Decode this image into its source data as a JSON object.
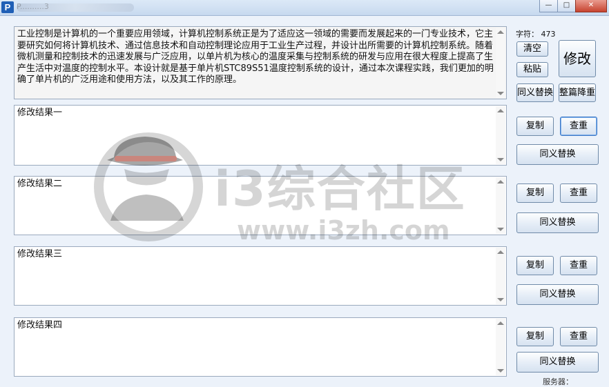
{
  "window": {
    "icon_letter": "P",
    "title_obscured": "P..........3",
    "minimize": "—",
    "maximize": "□",
    "close": "✕"
  },
  "source_text": "工业控制是计算机的一个重要应用领域，计算机控制系统正是为了适应这一领域的需要而发展起来的一门专业技术，它主要研究如何将计算机技术、通过信息技术和自动控制理论应用于工业生产过程，并设计出所需要的计算机控制系统。随着微机测量和控制技术的迅速发展与广泛应用，以单片机为核心的温度采集与控制系统的研发与应用在很大程度上提高了生产生活中对温度的控制水平。本设计就是基于单片机STC89S51温度控制系统的设计，通过本次课程实践，我们更加的明确了单片机的广泛用途和使用方法，以及其工作的原理。",
  "char_count": {
    "label": "字符：",
    "value": "473"
  },
  "buttons": {
    "clear": "清空",
    "paste": "粘贴",
    "modify": "修改",
    "synonym_top": "同义替换",
    "dedupe": "整篇降重",
    "copy": "复制",
    "check": "查重",
    "synonym": "同义替换"
  },
  "results": [
    {
      "label": "修改结果一"
    },
    {
      "label": "修改结果二"
    },
    {
      "label": "修改结果三"
    },
    {
      "label": "修改结果四"
    }
  ],
  "service_label": "服务器：",
  "watermark": {
    "main": "i3综合社区",
    "url": "www.i3zh.com"
  }
}
